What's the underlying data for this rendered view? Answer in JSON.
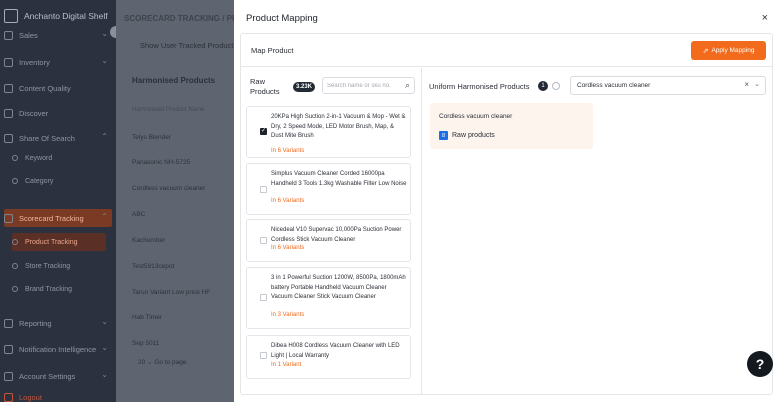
{
  "sidebar": {
    "brand": "Anchanto Digital Shelf",
    "items": [
      {
        "label": "Sales",
        "chevron": "⌄"
      },
      {
        "label": "Inventory",
        "chevron": "⌄"
      },
      {
        "label": "Content Quality"
      },
      {
        "label": "Discover"
      },
      {
        "label": "Share Of Search",
        "chevron": "⌃"
      },
      {
        "label": "Keyword"
      },
      {
        "label": "Category"
      },
      {
        "label": "Scorecard Tracking",
        "chevron": "⌃"
      },
      {
        "label": "Product Tracking"
      },
      {
        "label": "Store Tracking"
      },
      {
        "label": "Brand Tracking"
      },
      {
        "label": "Reporting",
        "chevron": "⌄"
      },
      {
        "label": "Notification Intelligence",
        "chevron": "⌄"
      },
      {
        "label": "Account Settings",
        "chevron": "⌄"
      },
      {
        "label": "Logout"
      }
    ]
  },
  "background": {
    "breadcrumb": "SCORECARD TRACKING / PRO",
    "show_button": "Show User Tracked Product",
    "header": "Harmonised Products",
    "subheader": "Harmonised Product Name",
    "rows": [
      "Telys Blender",
      "Panasonic NH-5725",
      "Cordless vacuum cleaner",
      "ABC",
      "Kachumber",
      "Test5913cepot",
      "Tarun Variant Low price HF",
      "Hab Timer",
      "Sep 5011"
    ],
    "pager": "20  ⌄     Go to page"
  },
  "modal": {
    "title": "Product Mapping",
    "close": "×",
    "map_label": "Map Product",
    "apply_button": "Apply Mapping",
    "apply_icon": "share-icon",
    "raw": {
      "title": "Raw Products",
      "count": "3.23K",
      "search_placeholder": "Search name or sku no."
    },
    "products": [
      {
        "title": "20KPa High Suction 2-in-1 Vacuum & Mop - Wet & Dry, 2 Speed Mode, LED Motor Brush, Map, & Dust Mite Brush",
        "variants": "In 6 Variants",
        "checked": true
      },
      {
        "title": "Simplus Vacuum Cleaner Corded 16000pa Handheld 3 Tools 1.3kg Washable Filter Low Noise",
        "variants": "In 6 Variants",
        "checked": false
      },
      {
        "title": "Nicedeal V10 Supervac 10,000Pa Suction Power Cordless Stick Vacuum Cleaner",
        "variants": "In 6 Variants",
        "checked": false
      },
      {
        "title": "3 in 1 Powerful Suction 1200W, 8500Pa, 1800mAh battery Portable Handheld Vacuum Cleaner Vacuum Cleaner Stick Vacuum Cleaner",
        "variants": "In 3 Variants",
        "checked": false
      },
      {
        "title": "Dibea H008 Cordless Vacuum Cleaner with LED Light | Local Warranty",
        "variants": "In 1 Variant",
        "checked": false
      }
    ],
    "uniform": {
      "title": "Uniform Harmonised Products",
      "count": "1",
      "selected": "Cordless vacuum cleaner",
      "clear": "×",
      "dropdown": "⌄"
    },
    "harmonised_card": {
      "name": "Cordless vacuum cleaner",
      "raw_badge": "8",
      "raw_label": "Raw products"
    }
  },
  "help": "?"
}
